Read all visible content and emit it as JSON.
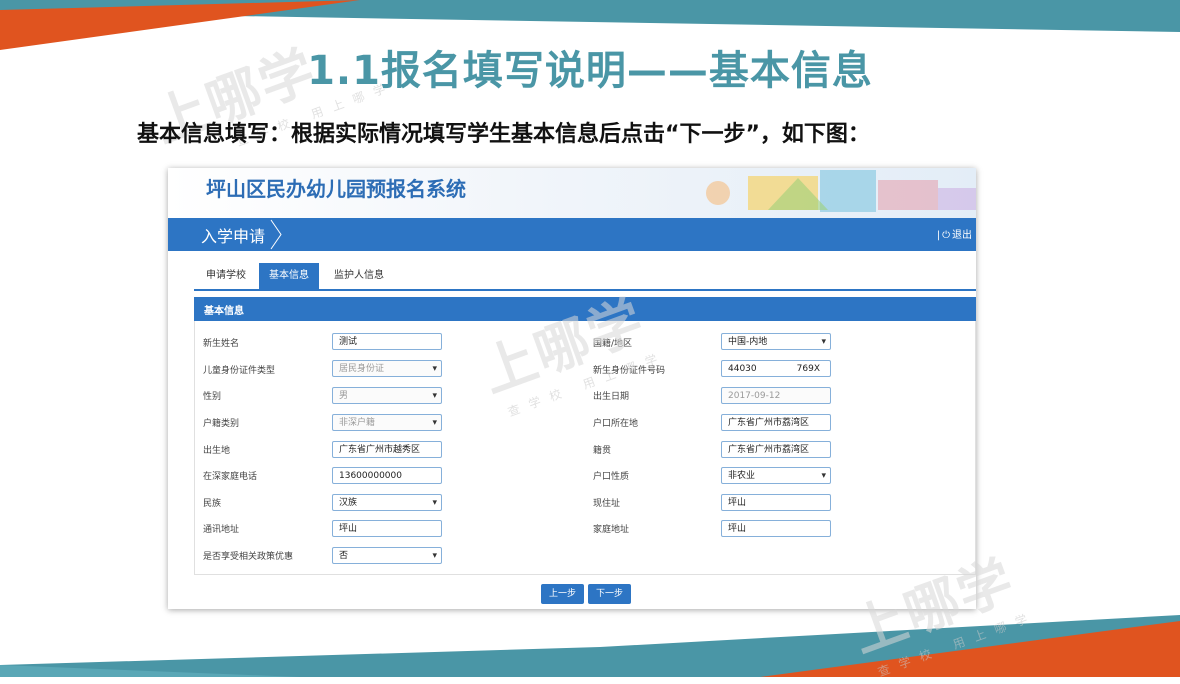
{
  "slide": {
    "title": "1.1报名填写说明——基本信息",
    "subtitle": "基本信息填写：根据实际情况填写学生基本信息后点击“下一步”，如下图：",
    "watermark_main": "上哪学",
    "watermark_sub": "查学校 用上哪学",
    "colors": {
      "teal": "#4a96a6",
      "orange": "#e0541f",
      "brand_blue": "#2d75c4"
    }
  },
  "app": {
    "title": "坪山区民办幼儿园预报名系统",
    "nav_title": "入学申请",
    "logout_label": "退出",
    "tabs": [
      "申请学校",
      "基本信息",
      "监护人信息"
    ],
    "active_tab": "基本信息",
    "section_title": "基本信息"
  },
  "form": {
    "left": [
      {
        "label": "新生姓名",
        "value": "测试",
        "type": "text"
      },
      {
        "label": "儿童身份证件类型",
        "value": "居民身份证",
        "type": "select",
        "disabled": true
      },
      {
        "label": "性别",
        "value": "男",
        "type": "select",
        "disabled": true
      },
      {
        "label": "户籍类别",
        "value": "非深户籍",
        "type": "select",
        "disabled": true
      },
      {
        "label": "出生地",
        "value": "广东省广州市越秀区",
        "type": "text"
      },
      {
        "label": "在深家庭电话",
        "value": "13600000000",
        "type": "text"
      },
      {
        "label": "民族",
        "value": "汉族",
        "type": "select"
      },
      {
        "label": "通讯地址",
        "value": "坪山",
        "type": "text"
      },
      {
        "label": "是否享受相关政策优惠",
        "value": "否",
        "type": "select"
      }
    ],
    "right": [
      {
        "label": "国籍/地区",
        "value": "中国-内地",
        "type": "select"
      },
      {
        "label": "新生身份证件号码",
        "value": "44030              769X",
        "type": "text"
      },
      {
        "label": "出生日期",
        "value": "2017-09-12",
        "type": "text",
        "disabled": true
      },
      {
        "label": "户口所在地",
        "value": "广东省广州市荔湾区",
        "type": "text"
      },
      {
        "label": "籍贯",
        "value": "广东省广州市荔湾区",
        "type": "text"
      },
      {
        "label": "户口性质",
        "value": "非农业",
        "type": "select"
      },
      {
        "label": "现住址",
        "value": "坪山",
        "type": "text"
      },
      {
        "label": "家庭地址",
        "value": "坪山",
        "type": "text"
      }
    ]
  },
  "buttons": {
    "prev": "上一步",
    "next": "下一步"
  }
}
